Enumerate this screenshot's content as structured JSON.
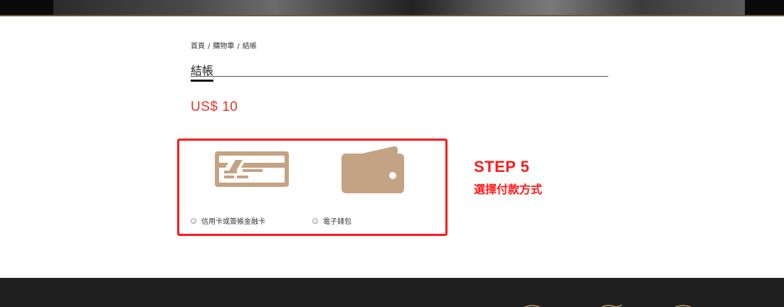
{
  "breadcrumb": {
    "items": [
      "首頁",
      "購物車",
      "結帳"
    ],
    "separator": "/"
  },
  "page": {
    "title": "結帳",
    "price": "US$ 10"
  },
  "payment": {
    "options": [
      {
        "label": "信用卡或簽帳金融卡",
        "icon": "credit-card-icon"
      },
      {
        "label": "電子錢包",
        "icon": "wallet-icon"
      }
    ],
    "icon_color": "#c4a384"
  },
  "annotation": {
    "step": "STEP 5",
    "description": "選擇付款方式",
    "color": "#ff1a1a"
  }
}
